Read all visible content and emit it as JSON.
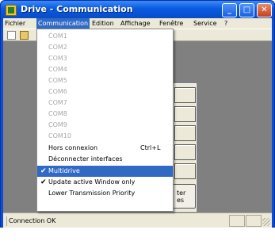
{
  "window": {
    "title": "Drive - Communication",
    "controls": {
      "minimize": "_",
      "maximize": "□",
      "close": "✕"
    }
  },
  "menubar": [
    "Fichier",
    "Communication",
    "Edition",
    "Affichage",
    "Fenêtre",
    "Service",
    "?"
  ],
  "dropdown": {
    "ports": [
      "COM1",
      "COM2",
      "COM3",
      "COM4",
      "COM5",
      "COM6",
      "COM7",
      "COM8",
      "COM9",
      "COM10"
    ],
    "hors_connexion": "Hors connexion",
    "hors_connexion_shortcut": "Ctrl+L",
    "deconnecter": "Déconnecter interfaces",
    "multidrive": "Multidrive",
    "update_active": "Update active Window only",
    "lower_priority": "Lower Transmission Priority",
    "check_glyph": "✔"
  },
  "background": {
    "button_line1": "ter",
    "button_line2": "es"
  },
  "statusbar": {
    "text": "Connection OK"
  },
  "colors": {
    "titlebar": "#0a5ce0",
    "highlight": "#316ac5",
    "client": "#808080",
    "menubar": "#ece9d8"
  }
}
